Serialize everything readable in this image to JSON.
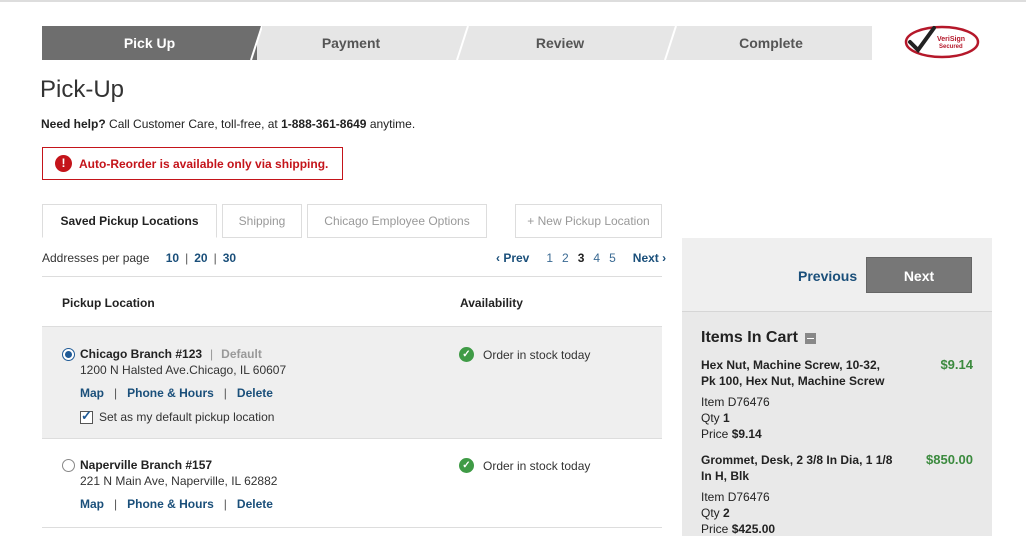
{
  "steps": [
    {
      "label": "Pick Up",
      "active": true
    },
    {
      "label": "Payment",
      "active": false
    },
    {
      "label": "Review",
      "active": false
    },
    {
      "label": "Complete",
      "active": false
    }
  ],
  "verisign": {
    "line1": "VeriSign",
    "line2": "Secured"
  },
  "page_title": "Pick-Up",
  "help": {
    "lead": "Need help?",
    "text": " Call Customer Care, toll-free, at ",
    "phone": "1-888-361-8649",
    "tail": " anytime."
  },
  "alert": {
    "icon": "!",
    "text": "Auto-Reorder is available only via shipping."
  },
  "tabs": {
    "saved": "Saved Pickup Locations",
    "shipping": "Shipping",
    "employee": "Chicago Employee Options",
    "new_location": "+ New Pickup Location"
  },
  "per_page": {
    "label": "Addresses per page",
    "options": [
      "10",
      "20",
      "30"
    ]
  },
  "pager": {
    "prev": "‹ Prev",
    "pages": [
      "1",
      "2",
      "3",
      "4",
      "5"
    ],
    "current": "3",
    "next": "Next ›"
  },
  "columns": {
    "location": "Pickup Location",
    "availability": "Availability"
  },
  "locations": [
    {
      "name": "Chicago Branch #123",
      "default_label": "Default",
      "address": "1200 N Halsted Ave.Chicago, IL 60607",
      "links": [
        "Map",
        "Phone & Hours",
        "Delete"
      ],
      "default_checkbox": "Set as my default pickup location",
      "availability": "Order in stock today"
    },
    {
      "name": "Naperville Branch #157",
      "address": "221 N Main Ave, Naperville, IL 62882",
      "links": [
        "Map",
        "Phone & Hours",
        "Delete"
      ],
      "availability": "Order in stock today"
    }
  ],
  "side": {
    "previous": "Previous",
    "next": "Next",
    "cart_title": "Items In Cart"
  },
  "cart_items": [
    {
      "name": "Hex Nut, Machine Screw, 10-32, Pk 100, Hex Nut, Machine Screw",
      "price": "$9.14",
      "item_label": "Item",
      "item_no": "D76476",
      "qty_label": "Qty",
      "qty": "1",
      "unit_label": "Price",
      "unit_price": "$9.14"
    },
    {
      "name": "Grommet, Desk, 2 3/8 In Dia, 1 1/8 In H, Blk",
      "price": "$850.00",
      "item_label": "Item",
      "item_no": "D76476",
      "qty_label": "Qty",
      "qty": "2",
      "unit_label": "Price",
      "unit_price": "$425.00"
    }
  ],
  "colors": {
    "accent": "#1a4f7a",
    "alert": "#c4141a",
    "success": "#3f9b46",
    "price": "#3b8a3e"
  }
}
